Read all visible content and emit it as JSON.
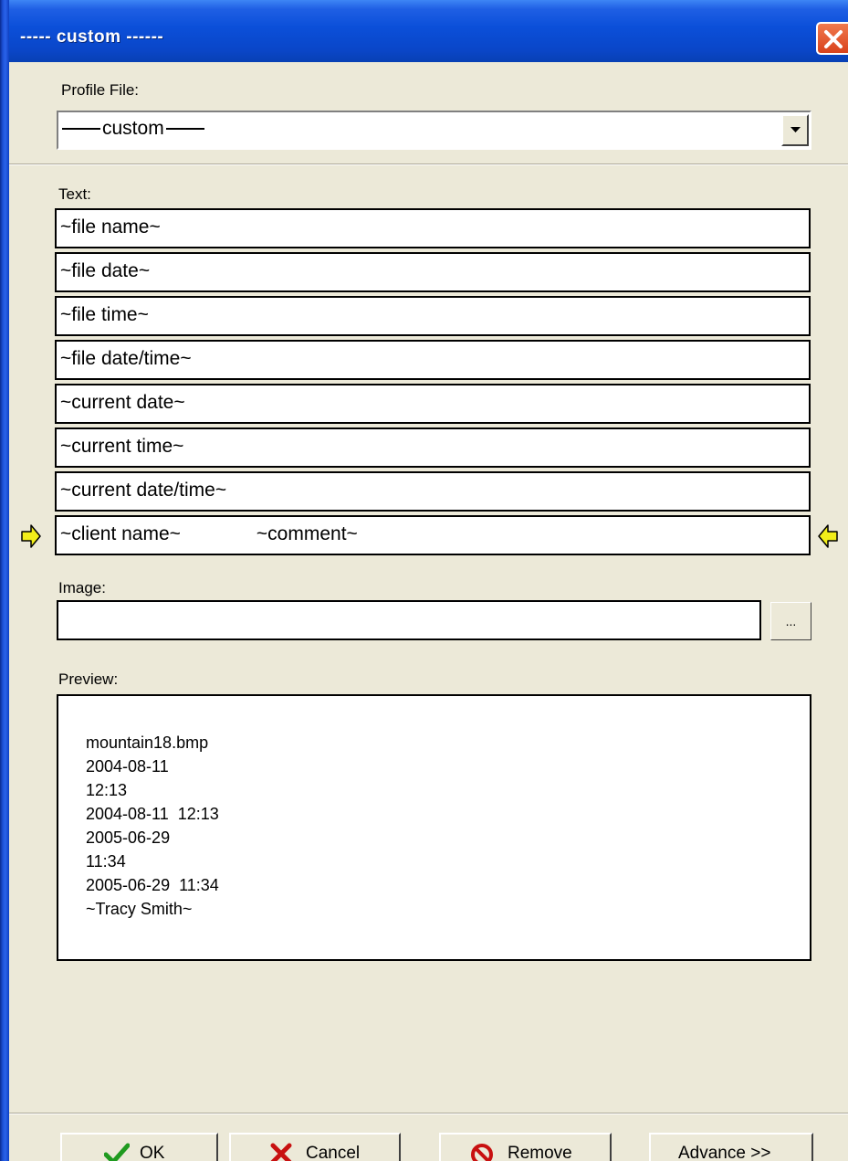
{
  "window": {
    "title": "----- custom ------"
  },
  "profile": {
    "label": "Profile File:",
    "value": "custom"
  },
  "text_section": {
    "label": "Text:",
    "fields": [
      "~file name~",
      "~file date~",
      "~file time~",
      "~file date/time~",
      "~current date~",
      "~current time~",
      "~current date/time~"
    ],
    "selected_field": {
      "left": "~client name~",
      "right": "~comment~"
    }
  },
  "image_section": {
    "label": "Image:",
    "value": "",
    "browse_label": "..."
  },
  "preview": {
    "label": "Preview:",
    "lines": [
      "mountain18.bmp",
      "2004-08-11",
      "12:13",
      "2004-08-11  12:13",
      "2005-06-29",
      "11:34",
      "2005-06-29  11:34",
      "~Tracy Smith~"
    ]
  },
  "buttons": {
    "ok": "OK",
    "cancel": "Cancel",
    "remove": "Remove",
    "advance": "Advance >>"
  },
  "icons": {
    "close": "close-icon",
    "dropdown": "chevron-down-icon",
    "ok": "checkmark-icon",
    "cancel": "x-icon",
    "remove": "no-entry-icon",
    "selection_markers": "arrow-icon"
  },
  "colors": {
    "titlebar": "#0a46c8",
    "face": "#ECE9D8",
    "close": "#e0532a",
    "ok_check": "#1f9a1f",
    "cancel_x": "#c81010",
    "remove_sign": "#c81010",
    "marker": "#f2ee1a"
  }
}
